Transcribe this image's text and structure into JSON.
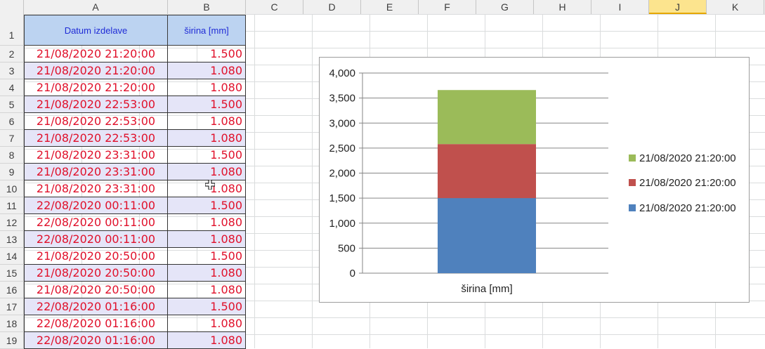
{
  "columns": [
    "A",
    "B",
    "C",
    "D",
    "E",
    "F",
    "G",
    "H",
    "I",
    "J",
    "K"
  ],
  "active_column": "J",
  "rows": [
    "1",
    "2",
    "3",
    "4",
    "5",
    "6",
    "7",
    "8",
    "9",
    "10",
    "11",
    "12",
    "13",
    "14",
    "15",
    "16",
    "17",
    "18",
    "19"
  ],
  "headers": {
    "date": "Datum izdelave",
    "width": "širina [mm]"
  },
  "table": [
    {
      "date": "21/08/2020 21:20:00",
      "value": "1.500"
    },
    {
      "date": "21/08/2020 21:20:00",
      "value": "1.080"
    },
    {
      "date": "21/08/2020 21:20:00",
      "value": "1.080"
    },
    {
      "date": "21/08/2020 22:53:00",
      "value": "1.500"
    },
    {
      "date": "21/08/2020 22:53:00",
      "value": "1.080"
    },
    {
      "date": "21/08/2020 22:53:00",
      "value": "1.080"
    },
    {
      "date": "21/08/2020 23:31:00",
      "value": "1.500"
    },
    {
      "date": "21/08/2020 23:31:00",
      "value": "1.080"
    },
    {
      "date": "21/08/2020 23:31:00",
      "value": "1.080"
    },
    {
      "date": "22/08/2020 00:11:00",
      "value": "1.500"
    },
    {
      "date": "22/08/2020 00:11:00",
      "value": "1.080"
    },
    {
      "date": "22/08/2020 00:11:00",
      "value": "1.080"
    },
    {
      "date": "21/08/2020 20:50:00",
      "value": "1.500"
    },
    {
      "date": "21/08/2020 20:50:00",
      "value": "1.080"
    },
    {
      "date": "21/08/2020 20:50:00",
      "value": "1.080"
    },
    {
      "date": "22/08/2020 01:16:00",
      "value": "1.500"
    },
    {
      "date": "22/08/2020 01:16:00",
      "value": "1.080"
    },
    {
      "date": "22/08/2020 01:16:00",
      "value": "1.080"
    }
  ],
  "colors": {
    "text_red": "#e0102a",
    "header_blue": "#1f2bd6",
    "header_bg": "#bcd3f1",
    "alt_row": "#e5e5f8"
  },
  "cursor_icon": "crosshair-cursor-icon",
  "chart_data": {
    "type": "bar",
    "stacked": true,
    "categories": [
      "širina [mm]"
    ],
    "ylim": [
      0,
      4000
    ],
    "yticks": [
      "0",
      "500",
      "1,000",
      "1,500",
      "2,000",
      "2,500",
      "3,000",
      "3,500",
      "4,000"
    ],
    "grid": true,
    "legend_position": "right",
    "series": [
      {
        "name": "21/08/2020 21:20:00",
        "values": [
          1500
        ],
        "color": "#4f81bd"
      },
      {
        "name": "21/08/2020 21:20:00",
        "values": [
          1080
        ],
        "color": "#c0504d"
      },
      {
        "name": "21/08/2020 21:20:00",
        "values": [
          1080
        ],
        "color": "#9bbb59"
      }
    ]
  }
}
